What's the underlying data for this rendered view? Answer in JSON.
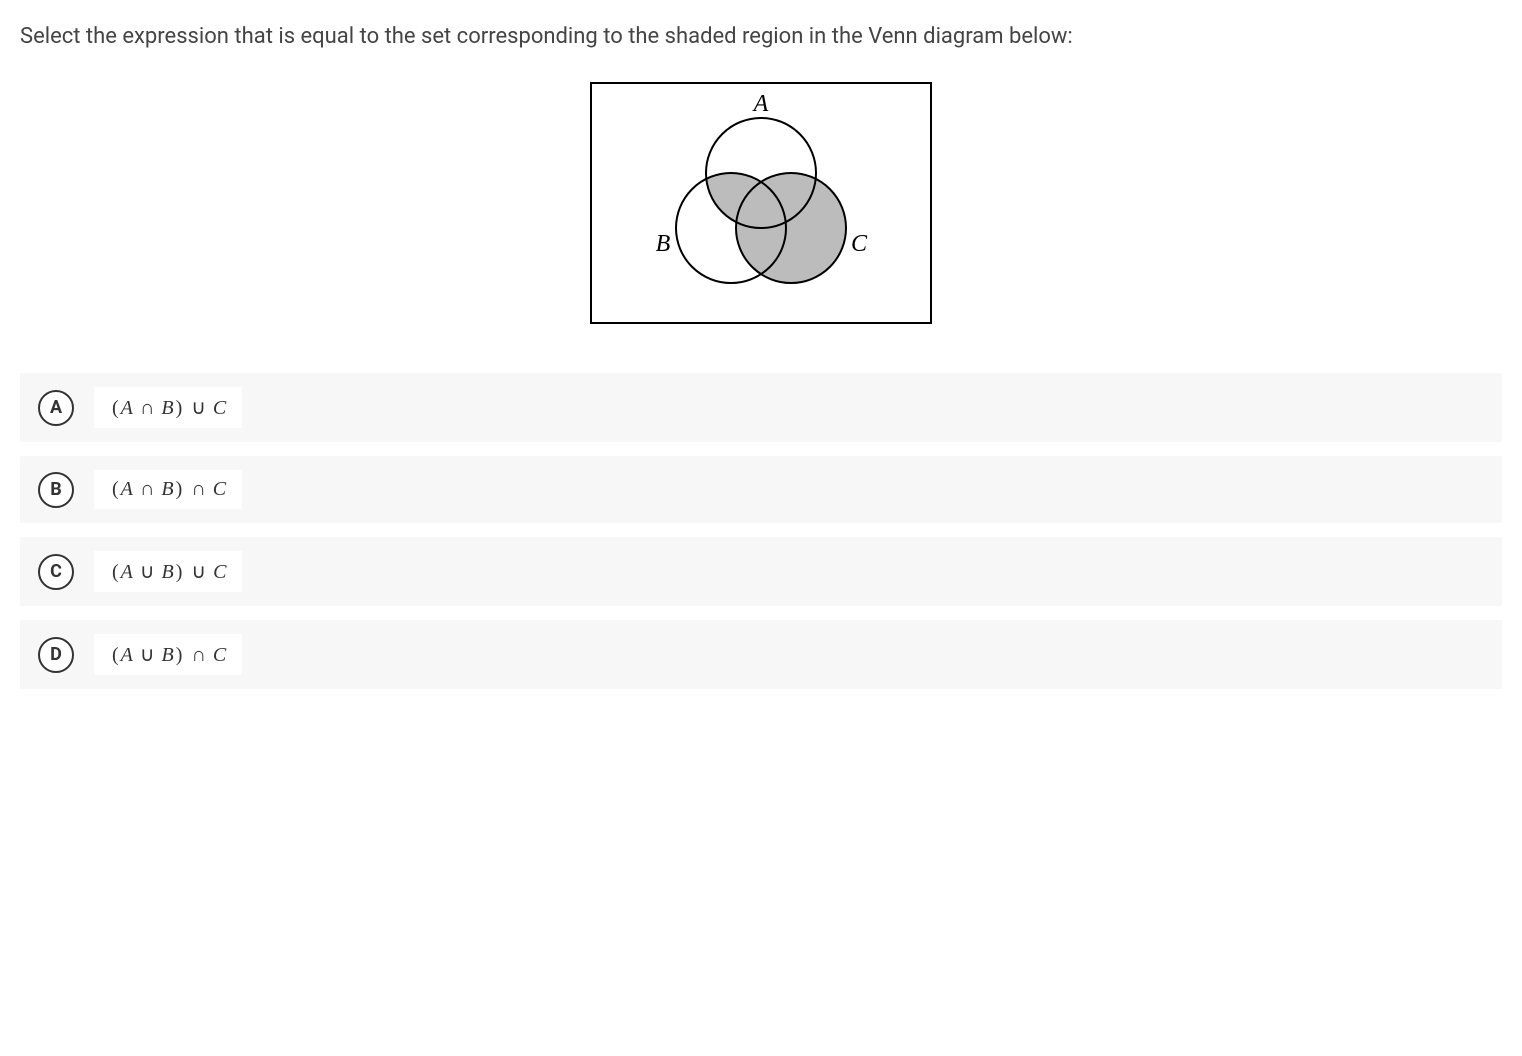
{
  "question": "Select the expression that is equal to the set corresponding to the shaded region in the Venn diagram below:",
  "diagram": {
    "labels": {
      "A": "A",
      "B": "B",
      "C": "C"
    }
  },
  "options": [
    {
      "letter": "A",
      "open": "(",
      "v1": "A",
      "op1": "∩",
      "v2": "B",
      "close": ")",
      "op2": "∪",
      "v3": "C"
    },
    {
      "letter": "B",
      "open": "(",
      "v1": "A",
      "op1": "∩",
      "v2": "B",
      "close": ")",
      "op2": "∩",
      "v3": "C"
    },
    {
      "letter": "C",
      "open": "(",
      "v1": "A",
      "op1": "∪",
      "v2": "B",
      "close": ")",
      "op2": "∪",
      "v3": "C"
    },
    {
      "letter": "D",
      "open": "(",
      "v1": "A",
      "op1": "∪",
      "v2": "B",
      "close": ")",
      "op2": "∩",
      "v3": "C"
    }
  ]
}
